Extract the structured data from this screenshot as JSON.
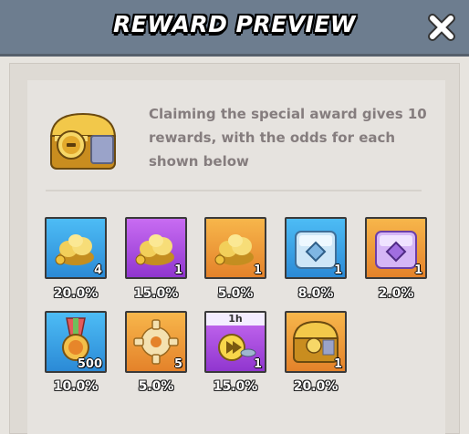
{
  "header": {
    "title": "REWARD PREVIEW",
    "close_icon": "close-icon"
  },
  "description": "Claiming the special award gives 10 rewards, with the odds for each shown below",
  "main_icon": "golden-chest-icon",
  "colors": {
    "blue_tile": "#3aa3e6",
    "purple_tile": "#a84ce0",
    "orange_tile": "#f0a03c"
  },
  "rewards": [
    {
      "icon": "gold-pile-icon",
      "tile_color": "blue",
      "count": "4",
      "odds": "20.0%"
    },
    {
      "icon": "gold-pile-icon",
      "tile_color": "purple",
      "count": "1",
      "odds": "15.0%"
    },
    {
      "icon": "gold-pile-icon",
      "tile_color": "orange",
      "count": "1",
      "odds": "5.0%"
    },
    {
      "icon": "ice-chest-icon",
      "tile_color": "blue",
      "count": "1",
      "odds": "8.0%"
    },
    {
      "icon": "purple-chest-icon",
      "tile_color": "orange",
      "count": "1",
      "odds": "2.0%"
    },
    {
      "icon": "medal-icon",
      "tile_color": "blue",
      "count": "500",
      "odds": "10.0%"
    },
    {
      "icon": "gear-icon",
      "tile_color": "orange",
      "count": "5",
      "odds": "5.0%"
    },
    {
      "icon": "speedup-icon",
      "tile_color": "purple",
      "count": "1",
      "timer": "1h",
      "odds": "15.0%"
    },
    {
      "icon": "golden-chest-icon",
      "tile_color": "orange",
      "count": "1",
      "odds": "20.0%"
    }
  ]
}
